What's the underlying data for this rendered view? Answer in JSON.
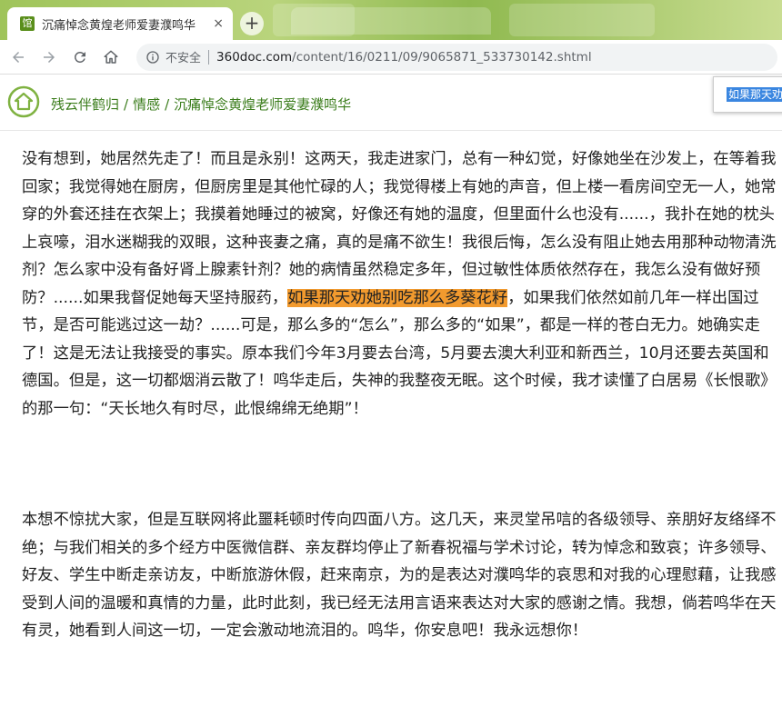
{
  "browser": {
    "tab_title": "沉痛悼念黄煌老师爱妻濮鸣华",
    "tab_favicon": "馆",
    "tab_close": "×",
    "new_tab": "+",
    "security_label": "不安全",
    "url_host": "360doc.com",
    "url_path": "/content/16/0211/09/9065871_533730142.shtml",
    "icons": {
      "back": "back-arrow-icon",
      "forward": "forward-arrow-icon",
      "reload": "reload-icon",
      "home": "home-icon",
      "info": "info-icon"
    },
    "accent": "#9fc45a"
  },
  "breadcrumb": {
    "items": [
      "残云伴鹤归",
      "情感"
    ],
    "current": "沉痛悼念黄煌老师爱妻濮鸣华",
    "separator": "/",
    "color": "#3b7d1c"
  },
  "popup": {
    "selected_text": "如果那天劝她"
  },
  "article": {
    "para1_before": "没有想到，她居然先走了！而且是永别！这两天，我走进家门，总有一种幻觉，好像她坐在沙发上，在等着我回家；我觉得她在厨房，但厨房里是其他忙碌的人；我觉得楼上有她的声音，但上楼一看房间空无一人，她常穿的外套还挂在衣架上；我摸着她睡过的被窝，好像还有她的温度，但里面什么也没有......，我扑在她的枕头上哀嚎，泪水迷糊我的双眼，这种丧妻之痛，真的是痛不欲生！我很后悔，怎么没有阻止她去用那种动物清洗剂？怎么家中没有备好肾上腺素针剂？她的病情虽然稳定多年，但过敏性体质依然存在，我怎么没有做好预防？......如果我督促她每天坚持服药，",
    "para1_highlight": "如果那天劝她别吃那么多葵花籽",
    "para1_after": "，如果我们依然如前几年一样出国过节，是否可能逃过这一劫？......可是，那么多的“怎么”，那么多的“如果”，都是一样的苍白无力。她确实走了！这是无法让我接受的事实。原本我们今年3月要去台湾，5月要去澳大利亚和新西兰，10月还要去英国和德国。但是，这一切都烟消云散了！鸣华走后，失神的我整夜无眠。这个时候，我才读懂了白居易《长恨歌》的那一句：“天长地久有时尽，此恨绵绵无绝期”！",
    "para2": "本想不惊扰大家，但是互联网将此噩耗顿时传向四面八方。这几天，来灵堂吊唁的各级领导、亲朋好友络绎不绝；与我们相关的多个经方中医微信群、亲友群均停止了新春祝福与学术讨论，转为悼念和致哀；许多领导、好友、学生中断走亲访友，中断旅游休假，赶来南京，为的是表达对濮鸣华的哀思和对我的心理慰藉，让我感受到人间的温暖和真情的力量，此时此刻，我已经无法用言语来表达对大家的感谢之情。我想，倘若鸣华在天有灵，她看到人间这一切，一定会激动地流泪的。鸣华，你安息吧！我永远想你！",
    "highlight_color": "#f29a2e"
  }
}
